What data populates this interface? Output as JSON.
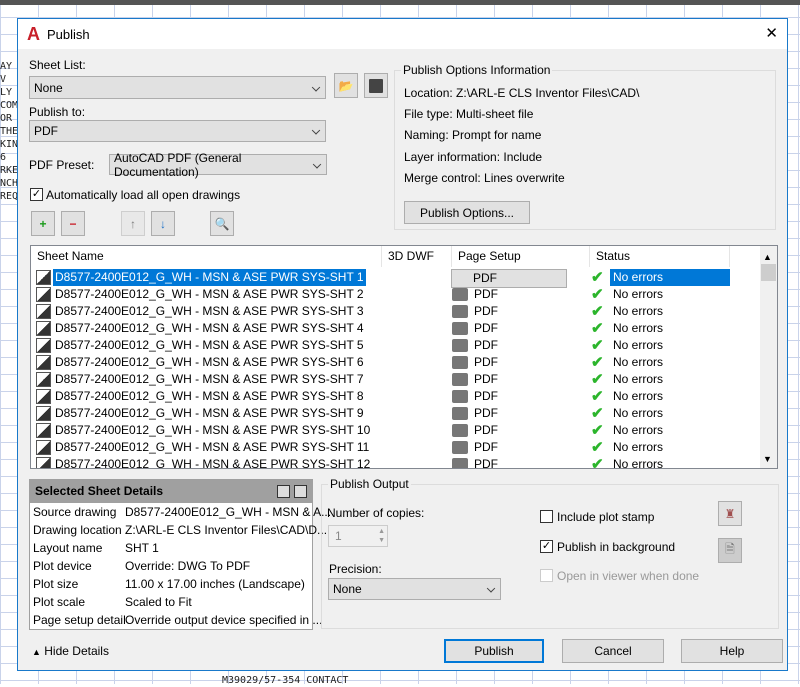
{
  "window": {
    "title": "Publish",
    "close": "✕"
  },
  "sheet_list": {
    "label": "Sheet List:",
    "value": "None"
  },
  "publish_to": {
    "label": "Publish to:",
    "value": "PDF"
  },
  "pdf_preset": {
    "label": "PDF Preset:",
    "value": "AutoCAD PDF (General Documentation)"
  },
  "auto_load": {
    "label": "Automatically load all open drawings",
    "checked": true
  },
  "info": {
    "title": "Publish Options Information",
    "lines": [
      "Location: Z:\\ARL-E CLS Inventor Files\\CAD\\",
      "File type: Multi-sheet file",
      "Naming: Prompt for name",
      "Layer information: Include",
      "Merge control: Lines overwrite"
    ],
    "button": "Publish Options..."
  },
  "table": {
    "headers": [
      "Sheet Name",
      "3D DWF",
      "Page Setup",
      "Status"
    ],
    "rows": [
      {
        "name": "D8577-2400E012_G_WH - MSN & ASE PWR SYS-SHT 1",
        "setup": "PDF",
        "status": "No errors"
      },
      {
        "name": "D8577-2400E012_G_WH - MSN & ASE PWR SYS-SHT 2",
        "setup": "PDF",
        "status": "No errors"
      },
      {
        "name": "D8577-2400E012_G_WH - MSN & ASE PWR SYS-SHT 3",
        "setup": "PDF",
        "status": "No errors"
      },
      {
        "name": "D8577-2400E012_G_WH - MSN & ASE PWR SYS-SHT 4",
        "setup": "PDF",
        "status": "No errors"
      },
      {
        "name": "D8577-2400E012_G_WH - MSN & ASE PWR SYS-SHT 5",
        "setup": "PDF",
        "status": "No errors"
      },
      {
        "name": "D8577-2400E012_G_WH - MSN & ASE PWR SYS-SHT 6",
        "setup": "PDF",
        "status": "No errors"
      },
      {
        "name": "D8577-2400E012_G_WH - MSN & ASE PWR SYS-SHT 7",
        "setup": "PDF",
        "status": "No errors"
      },
      {
        "name": "D8577-2400E012_G_WH - MSN & ASE PWR SYS-SHT 8",
        "setup": "PDF",
        "status": "No errors"
      },
      {
        "name": "D8577-2400E012_G_WH - MSN & ASE PWR SYS-SHT 9",
        "setup": "PDF",
        "status": "No errors"
      },
      {
        "name": "D8577-2400E012_G_WH - MSN & ASE PWR SYS-SHT 10",
        "setup": "PDF",
        "status": "No errors"
      },
      {
        "name": "D8577-2400E012_G_WH - MSN & ASE PWR SYS-SHT 11",
        "setup": "PDF",
        "status": "No errors"
      },
      {
        "name": "D8577-2400E012_G_WH - MSN & ASE PWR SYS-SHT 12",
        "setup": "PDF",
        "status": "No errors"
      }
    ]
  },
  "details": {
    "title": "Selected Sheet Details",
    "rows": [
      {
        "k": "Source drawing",
        "v": "D8577-2400E012_G_WH - MSN & A..."
      },
      {
        "k": "Drawing location",
        "v": "Z:\\ARL-E CLS Inventor Files\\CAD\\D..."
      },
      {
        "k": "Layout name",
        "v": "SHT 1"
      },
      {
        "k": "Plot device",
        "v": "Override: DWG To PDF"
      },
      {
        "k": "Plot size",
        "v": "11.00 x 17.00 inches (Landscape)"
      },
      {
        "k": "Plot scale",
        "v": "Scaled to Fit"
      },
      {
        "k": "Page setup detail",
        "v": "Override output device specified in ..."
      }
    ]
  },
  "output": {
    "title": "Publish Output",
    "copies_label": "Number of copies:",
    "copies": "1",
    "precision_label": "Precision:",
    "precision": "None",
    "plot_stamp": "Include plot stamp",
    "background": "Publish in background",
    "viewer": "Open in viewer when done"
  },
  "footer": {
    "hide": "Hide Details",
    "publish": "Publish",
    "cancel": "Cancel",
    "help": "Help"
  },
  "background_text": {
    "left": [
      "AY",
      "V",
      "LY",
      "",
      "COM",
      "OR",
      "THE",
      "KING",
      "6",
      "RKE",
      "NCH",
      "",
      "REQ"
    ],
    "bottom": "M39029/57-354 CONTACT"
  },
  "colors": {
    "accent": "#0078d7",
    "ok": "#2cb52c"
  }
}
